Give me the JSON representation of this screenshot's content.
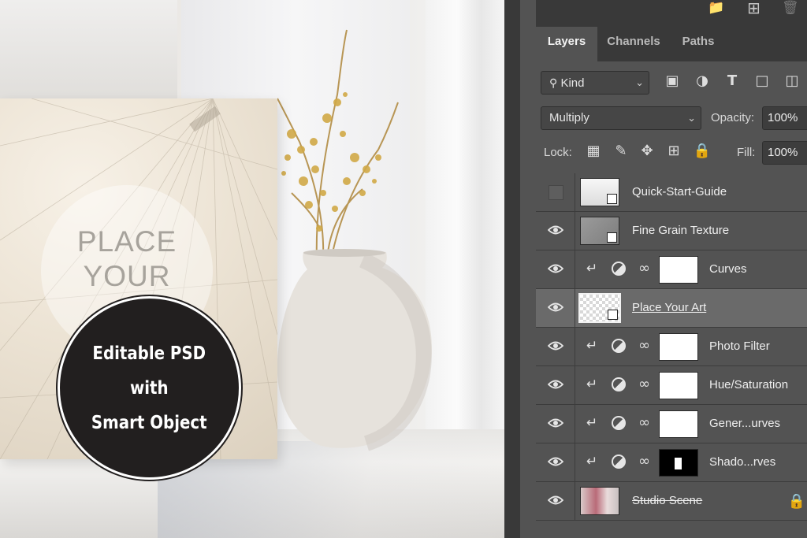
{
  "mockup": {
    "place_line1": "PLACE",
    "place_line2": "YOUR",
    "badge_line1": "Editable PSD",
    "badge_line2": "with",
    "badge_line3": "Smart Object"
  },
  "panel": {
    "tabs": [
      {
        "label": "Layers",
        "active": true
      },
      {
        "label": "Channels",
        "active": false
      },
      {
        "label": "Paths",
        "active": false
      }
    ],
    "filter": {
      "label": "Kind",
      "icon": "search-icon"
    },
    "blend_mode": "Multiply",
    "opacity_label": "Opacity:",
    "opacity_value": "100%",
    "lock_label": "Lock:",
    "fill_label": "Fill:",
    "fill_value": "100%"
  },
  "layers": [
    {
      "name": "Quick-Start-Guide",
      "visible": false,
      "kind": "smart"
    },
    {
      "name": "Fine Grain Texture",
      "visible": true,
      "kind": "smart"
    },
    {
      "name": "Curves",
      "visible": true,
      "kind": "adjustment"
    },
    {
      "name": "Place Your Art",
      "visible": true,
      "kind": "smart",
      "selected": true
    },
    {
      "name": "Photo Filter",
      "visible": true,
      "kind": "adjustment"
    },
    {
      "name": "Hue/Saturation",
      "visible": true,
      "kind": "adjustment"
    },
    {
      "name": "Gener...urves",
      "visible": true,
      "kind": "adjustment"
    },
    {
      "name": "Shado...rves",
      "visible": true,
      "kind": "adjustment",
      "mask": "dark"
    },
    {
      "name": "Studio Scene",
      "visible": true,
      "kind": "image",
      "locked": true
    }
  ],
  "colors": {
    "panel_bg": "#535353",
    "panel_dark": "#393939",
    "selected_row": "#6a6a6a",
    "badge_bg": "#221f1f"
  }
}
